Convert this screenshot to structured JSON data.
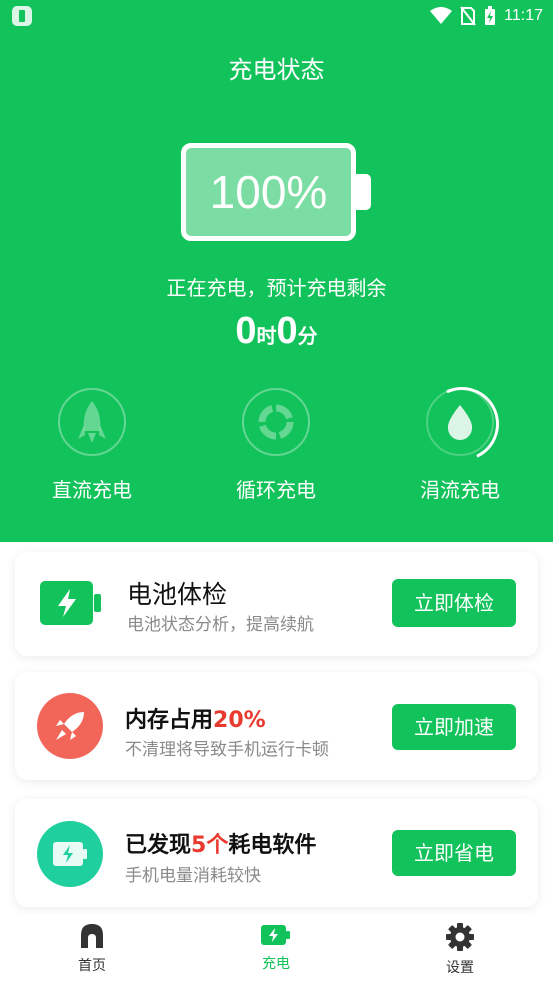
{
  "status_bar": {
    "time": "11:17"
  },
  "header": {
    "title": "充电状态"
  },
  "battery": {
    "percent_text": "100%",
    "level": 1.0
  },
  "charge": {
    "status_text": "正在充电，预计充电剩余",
    "hours": "0",
    "hours_unit": "时",
    "minutes": "0",
    "minutes_unit": "分"
  },
  "modes": [
    {
      "label": "直流充电",
      "icon": "rocket-icon"
    },
    {
      "label": "循环充电",
      "icon": "recycle-icon"
    },
    {
      "label": "涓流充电",
      "icon": "droplet-icon"
    }
  ],
  "cards": [
    {
      "title": "电池体检",
      "title_highlight": "",
      "title_suffix": "",
      "subtitle": "电池状态分析，提高续航",
      "button": "立即体检",
      "icon": "battery-charging-icon",
      "icon_color": "#12c25a"
    },
    {
      "title": "内存占用",
      "title_highlight": "20%",
      "title_suffix": "",
      "subtitle": "不清理将导致手机运行卡顿",
      "button": "立即加速",
      "icon": "rocket-icon",
      "icon_color": "#f2665a"
    },
    {
      "title": "已发现",
      "title_highlight": "5个",
      "title_suffix": "耗电软件",
      "subtitle": "手机电量消耗较快",
      "button": "立即省电",
      "icon": "battery-save-icon",
      "icon_color": "#1fcf9d"
    }
  ],
  "tabs": [
    {
      "label": "首页",
      "icon": "home-icon",
      "active": false
    },
    {
      "label": "充电",
      "icon": "charging-icon",
      "active": true
    },
    {
      "label": "设置",
      "icon": "gear-icon",
      "active": false
    }
  ],
  "colors": {
    "brand": "#12c25a",
    "highlight": "#e83a2f"
  }
}
